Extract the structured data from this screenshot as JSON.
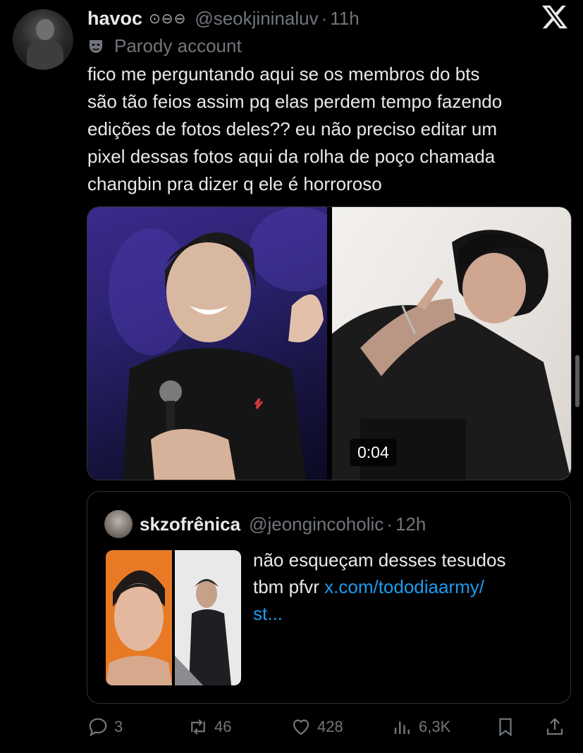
{
  "post": {
    "display_name": "havoc",
    "badges": "⊙⊖⊖",
    "handle": "@seokjininaluv",
    "separator": "·",
    "time": "11h",
    "parody_label": "Parody account",
    "text": "fico me perguntando aqui se os membros do bts\nsão tão feios assim pq elas perdem tempo fazendo\nedições de fotos deles?? eu não preciso editar um\npixel dessas fotos aqui da rolha de poço chamada\nchangbin pra dizer q ele é horroroso",
    "video_duration": "0:04"
  },
  "quote": {
    "display_name": "skzofrênica",
    "handle": "@jeongincoholic",
    "separator": "·",
    "time": "12h",
    "text": "não esqueçam desses tesudos\ntbm pfvr ",
    "link": "x.com/tododiaarmy/\nst..."
  },
  "actions": {
    "replies": "3",
    "reposts": "46",
    "likes": "428",
    "views": "6,3K"
  },
  "icons": {
    "logo": "x-logo-icon",
    "parody": "mask-icon",
    "reply": "reply-icon",
    "repost": "repost-icon",
    "like": "heart-icon",
    "views": "views-icon",
    "bookmark": "bookmark-icon",
    "share": "share-icon"
  },
  "colors": {
    "background": "#000000",
    "text": "#e7e9ea",
    "muted": "#71767b",
    "link": "#1d9bf0",
    "border": "#2f3336"
  }
}
